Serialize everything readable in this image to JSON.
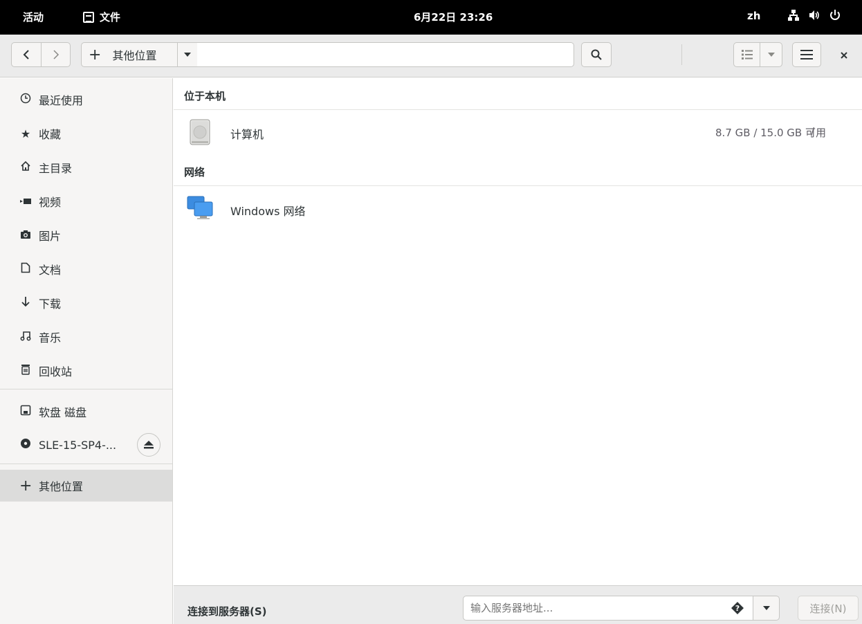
{
  "topbar": {
    "activities": "活动",
    "app_name": "文件",
    "clock": "6月22日 23:26",
    "lang": "zh"
  },
  "headerbar": {
    "location_label": "其他位置"
  },
  "sidebar": {
    "items": [
      {
        "label": "最近使用",
        "icon": "clock-icon"
      },
      {
        "label": "收藏",
        "icon": "star-icon"
      },
      {
        "label": "主目录",
        "icon": "home-icon"
      },
      {
        "label": "视频",
        "icon": "video-icon"
      },
      {
        "label": "图片",
        "icon": "camera-icon"
      },
      {
        "label": "文档",
        "icon": "document-icon"
      },
      {
        "label": "下载",
        "icon": "download-icon"
      },
      {
        "label": "音乐",
        "icon": "music-icon"
      },
      {
        "label": "回收站",
        "icon": "trash-icon"
      }
    ],
    "devices": [
      {
        "label": "软盘 磁盘",
        "icon": "floppy-icon"
      },
      {
        "label": "SLE-15-SP4-...",
        "icon": "disc-icon"
      }
    ],
    "other_locations": "其他位置"
  },
  "main": {
    "section_local": "位于本机",
    "computer": {
      "name": "计算机",
      "usage": "8.7 GB / 15.0 GB 可用",
      "mount": "/"
    },
    "section_network": "网络",
    "network": {
      "name": "Windows 网络"
    }
  },
  "bottom": {
    "label": "连接到服务器(S)",
    "placeholder": "输入服务器地址...",
    "connect": "连接(N)"
  }
}
